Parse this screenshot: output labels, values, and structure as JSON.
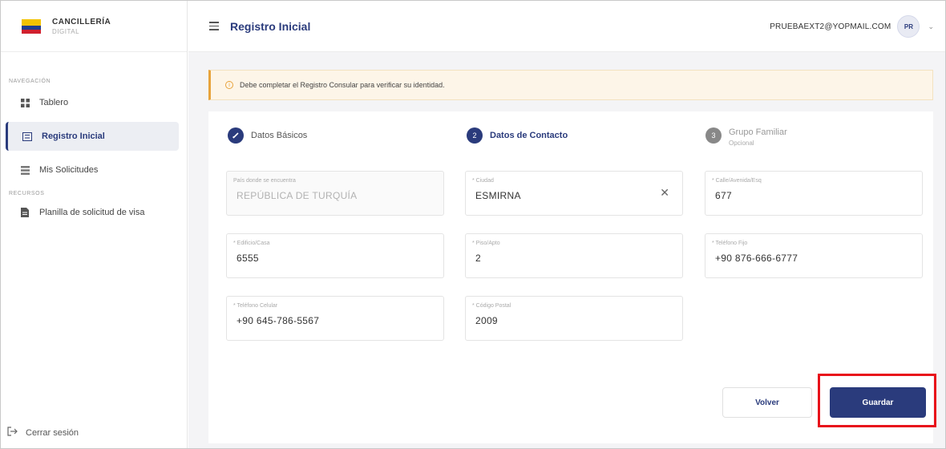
{
  "brand": {
    "name": "CANCILLERÍA",
    "subtitle": "DIGITAL"
  },
  "sidebar": {
    "section_nav": "NAVEGACIÓN",
    "items": [
      {
        "label": "Tablero",
        "icon": "dashboard-icon",
        "active": false
      },
      {
        "label": "Registro Inicial",
        "icon": "register-icon",
        "active": true
      },
      {
        "label": "Mis Solicitudes",
        "icon": "list-icon",
        "active": false
      }
    ],
    "section_resources": "RECURSOS",
    "resources": [
      {
        "label": "Planilla de solicitud de visa",
        "icon": "document-icon"
      }
    ],
    "logout_label": "Cerrar sesión"
  },
  "topbar": {
    "title": "Registro Inicial",
    "email": "PRUEBAEXT2@YOPMAIL.COM",
    "avatar_initials": "PR"
  },
  "alert": {
    "text": "Debe completar el Registro Consular para verificar su identidad."
  },
  "steps": [
    {
      "label": "Datos Básicos",
      "state": "done",
      "number": "✓"
    },
    {
      "label": "Datos de Contacto",
      "state": "active",
      "number": "2"
    },
    {
      "label": "Grupo Familiar",
      "sub": "Opcional",
      "state": "pending",
      "number": "3"
    }
  ],
  "form": {
    "pais": {
      "label": "País donde se encuentra",
      "value": "REPÚBLICA DE TURQUÍA"
    },
    "ciudad": {
      "label": "* Ciudad",
      "value": "ESMIRNA"
    },
    "calle": {
      "label": "* Calle/Avenida/Esq",
      "value": "677"
    },
    "edificio": {
      "label": "* Edificio/Casa",
      "value": "6555"
    },
    "piso": {
      "label": "* Piso/Apto",
      "value": "2"
    },
    "telefono_fijo": {
      "label": "* Teléfono Fijo",
      "value": "+90 876-666-6777"
    },
    "telefono_celular": {
      "label": "* Teléfono Celular",
      "value": "+90 645-786-5567"
    },
    "codigo_postal": {
      "label": "* Código Postal",
      "value": "2009"
    }
  },
  "buttons": {
    "back": "Volver",
    "save": "Guardar"
  },
  "colors": {
    "primary": "#2a3b7c",
    "warning": "#e8a33c",
    "highlight": "#e8111a"
  }
}
